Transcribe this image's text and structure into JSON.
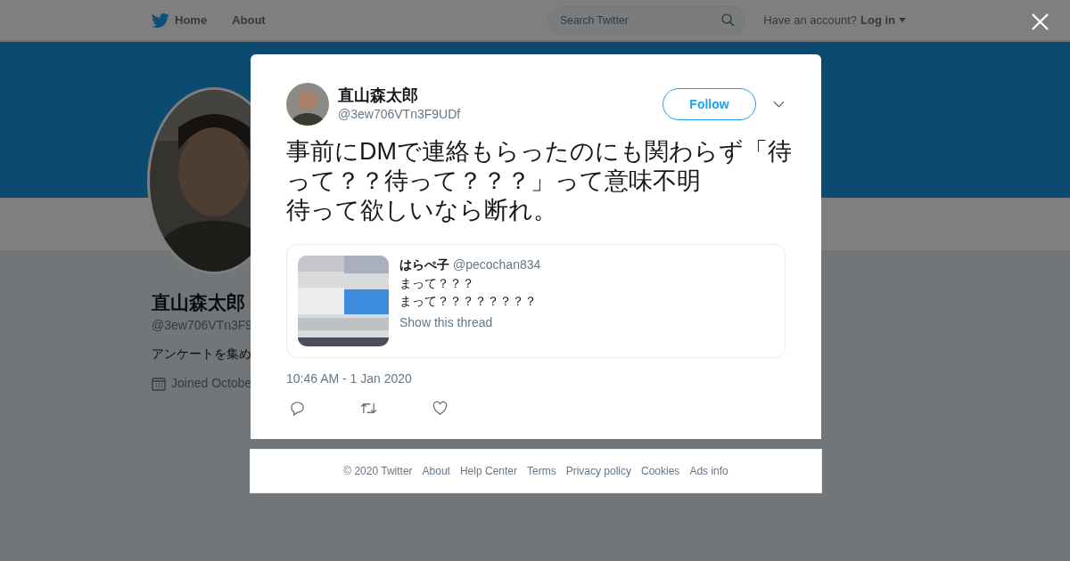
{
  "nav": {
    "items": [
      {
        "label": "Home",
        "kind": "home"
      },
      {
        "label": "About",
        "kind": "link"
      }
    ],
    "search": {
      "placeholder": "Search Twitter"
    },
    "account_prompt": "Have an account?",
    "login": "Log in"
  },
  "profile": {
    "name": "直山森太郎",
    "handle": "@3ew706VTn3F9",
    "bio": "アンケートを集め",
    "joined": "Joined Octobe"
  },
  "tweet": {
    "author": {
      "name": "直山森太郎",
      "handle": "@3ew706VTn3F9UDf"
    },
    "follow_button": "Follow",
    "text_lines": [
      "事前にDMで連絡もらったのにも関わらず「待って？？待って？？？」って意味不明",
      "待って欲しいなら断れ。"
    ],
    "quoted": {
      "name": "はらぺ子",
      "handle": "@pecochan834",
      "lines": [
        "まって？？？",
        "まって？？？？？？？？"
      ],
      "thread_link": "Show this thread"
    },
    "timestamp": "10:46 AM - 1 Jan 2020"
  },
  "footer": [
    "© 2020 Twitter",
    "About",
    "Help Center",
    "Terms",
    "Privacy policy",
    "Cookies",
    "Ads info"
  ]
}
